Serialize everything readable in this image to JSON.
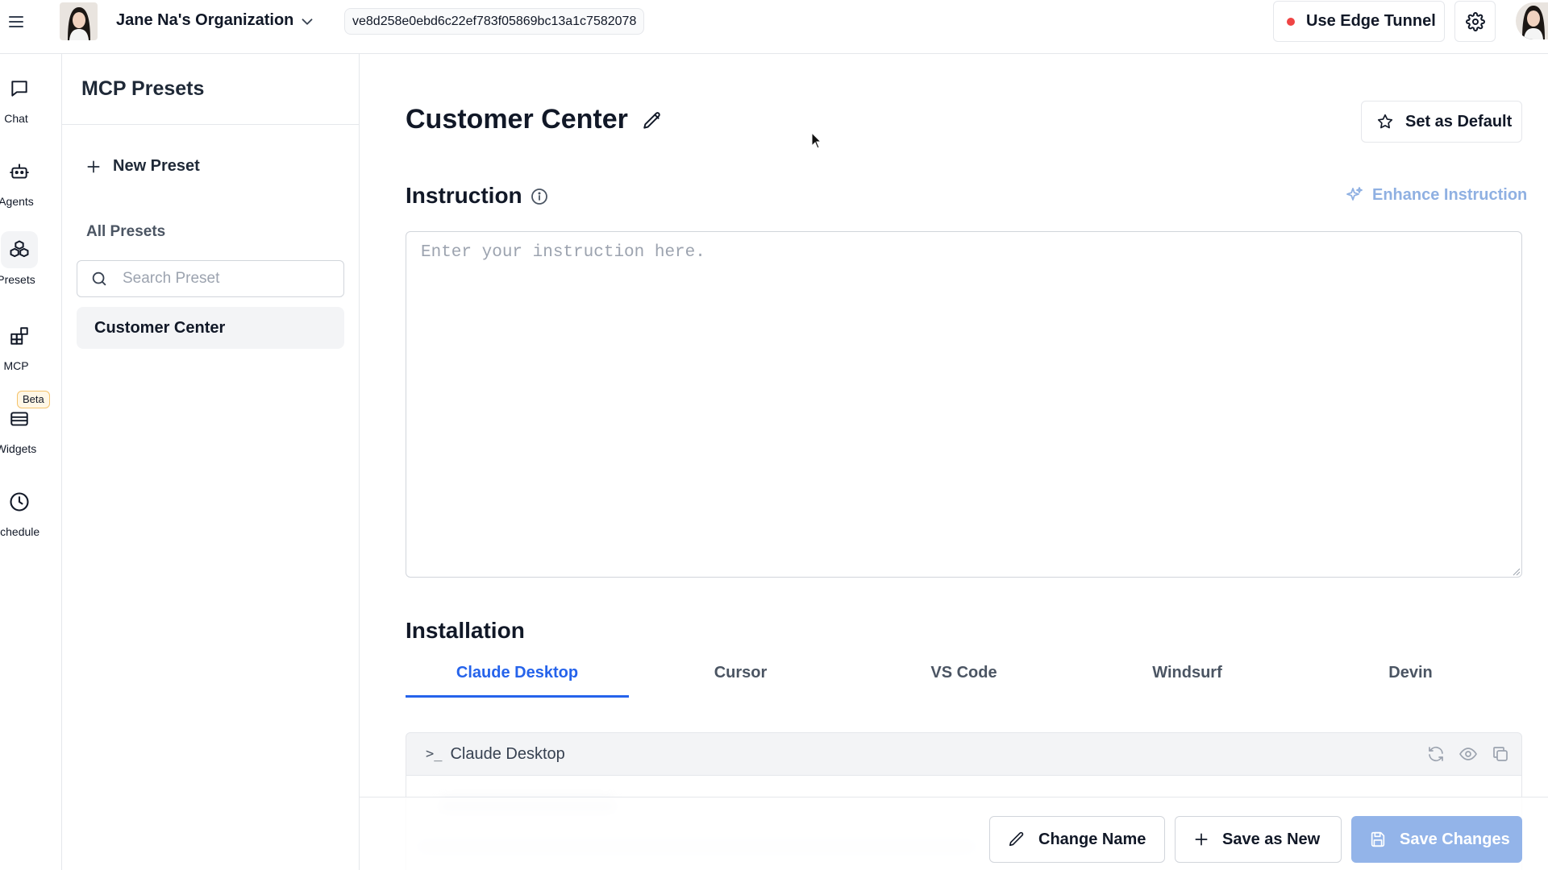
{
  "topbar": {
    "org_name": "Jane Na's Organization",
    "session_hash": "ve8d258e0ebd6c22ef783f05869bc13a1c7582078",
    "tunnel_label": "Use Edge Tunnel",
    "tunnel_status_color": "#ef4444"
  },
  "rail": {
    "items": [
      {
        "label": "Chat",
        "icon": "chat-bubble-icon"
      },
      {
        "label": "Agents",
        "icon": "robot-icon"
      },
      {
        "label": "Presets",
        "icon": "cubes-icon",
        "active": true
      },
      {
        "label": "MCP",
        "icon": "blocks-icon"
      },
      {
        "label": "Widgets",
        "icon": "widget-window-icon",
        "badge": "Beta"
      },
      {
        "label": "Schedule",
        "icon": "clock-icon"
      }
    ]
  },
  "panel": {
    "title": "MCP Presets",
    "new_preset_label": "New Preset",
    "all_presets_label": "All Presets",
    "search_placeholder": "Search Preset",
    "presets": [
      "Customer Center"
    ]
  },
  "main": {
    "preset_title": "Customer Center",
    "set_default_label": "Set as Default",
    "instruction_heading": "Instruction",
    "enhance_label": "Enhance Instruction",
    "instruction_placeholder": "Enter your instruction here.",
    "instruction_value": "",
    "installation_heading": "Installation",
    "tabs": [
      "Claude Desktop",
      "Cursor",
      "VS Code",
      "Windsurf",
      "Devin"
    ],
    "active_tab": "Claude Desktop",
    "code_block_title": "Claude Desktop",
    "code_actions": [
      "refresh-icon",
      "eye-icon",
      "copy-icon"
    ]
  },
  "footer": {
    "change_name_label": "Change Name",
    "save_as_new_label": "Save as New",
    "save_changes_label": "Save Changes"
  },
  "colors": {
    "accent": "#2563eb",
    "enhance": "#8fb0e2",
    "save_disabled": "#93b4e9",
    "badge_border": "#f5c36b"
  }
}
